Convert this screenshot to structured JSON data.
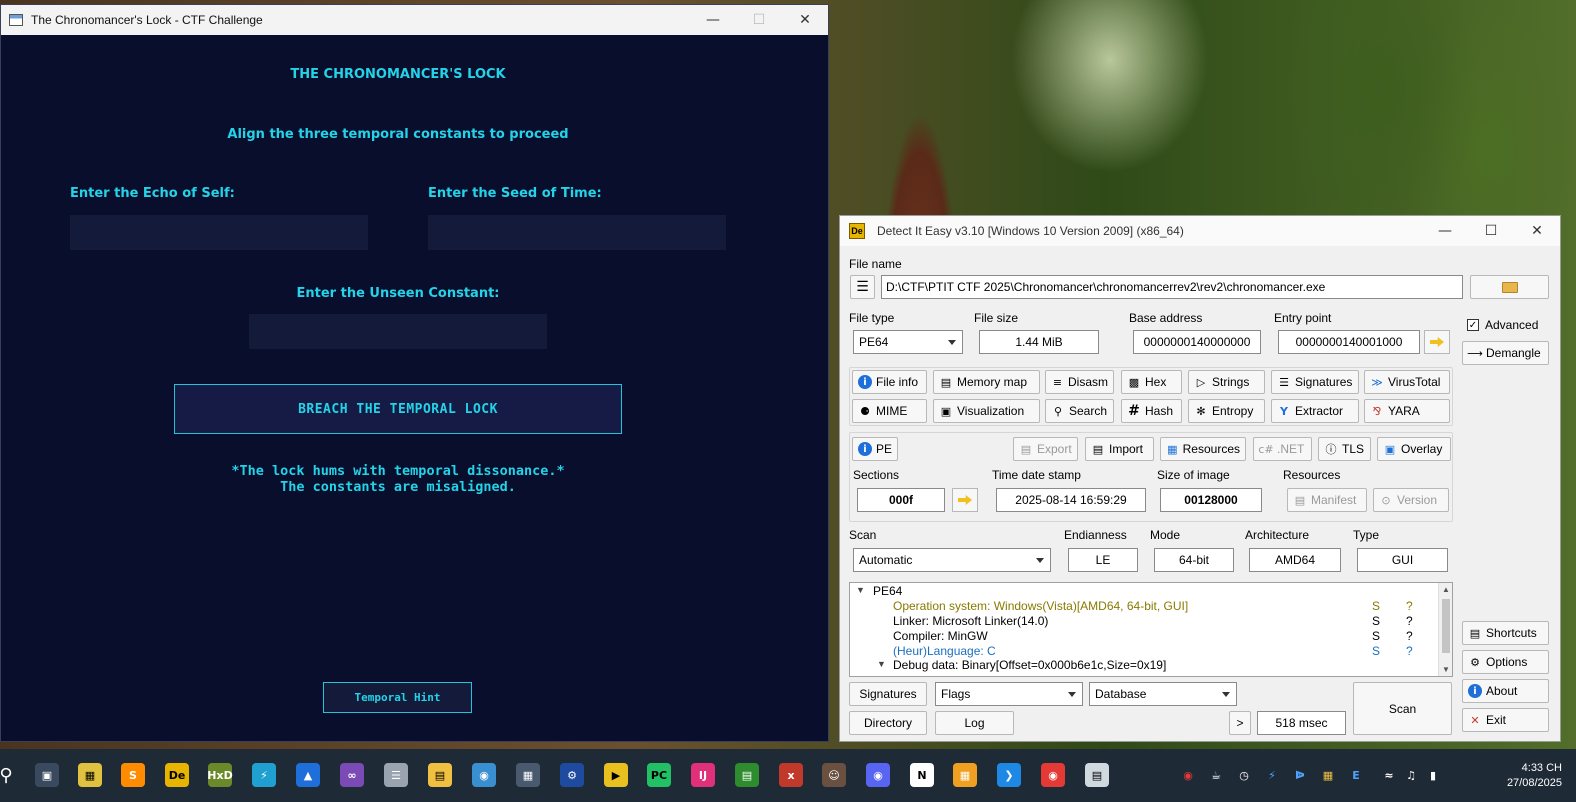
{
  "game": {
    "window_title": "The Chronomancer's Lock - CTF Challenge",
    "heading": "THE CHRONOMANCER'S LOCK",
    "subtitle": "Align the three temporal constants to proceed",
    "label_echo": "Enter the Echo of Self:",
    "label_seed": "Enter the Seed of Time:",
    "label_unseen": "Enter the Unseen Constant:",
    "input_echo": "",
    "input_seed": "",
    "input_unseen": "",
    "breach_button": "BREACH THE TEMPORAL LOCK",
    "status_line1": "*The lock hums with temporal dissonance.*",
    "status_line2": "The constants are misaligned.",
    "hint_button": "Temporal Hint",
    "colors": {
      "background": "#0a0e2d",
      "accent": "#23d3e8"
    }
  },
  "die": {
    "window_title": "Detect It Easy v3.10 [Windows 10 Version 2009] (x86_64)",
    "file_name_label": "File name",
    "file_path": "D:\\CTF\\PTIT CTF 2025\\Chronomancer\\chronomancerrev2\\rev2\\chronomancer.exe",
    "file_type_label": "File type",
    "file_type_value": "PE64",
    "file_size_label": "File size",
    "file_size_value": "1.44 MiB",
    "base_address_label": "Base address",
    "base_address_value": "0000000140000000",
    "entry_point_label": "Entry point",
    "entry_point_value": "0000000140001000",
    "advanced_label": "Advanced",
    "advanced_checked": true,
    "demangle": "Demangle",
    "tools_row1": [
      "File info",
      "Memory map",
      "Disasm",
      "Hex",
      "Strings",
      "Signatures",
      "VirusTotal"
    ],
    "tools_row2": [
      "MIME",
      "Visualization",
      "Search",
      "Hash",
      "Entropy",
      "Extractor",
      "YARA"
    ],
    "pe_button": "PE",
    "pe_tools": [
      "Export",
      "Import",
      "Resources",
      ".NET",
      "TLS",
      "Overlay"
    ],
    "sections_label": "Sections",
    "sections_value": "000f",
    "timestamp_label": "Time date stamp",
    "timestamp_value": "2025-08-14 16:59:29",
    "size_of_image_label": "Size of image",
    "size_of_image_value": "00128000",
    "resources_label": "Resources",
    "manifest_button": "Manifest",
    "version_button": "Version",
    "scan_label": "Scan",
    "scan_value": "Automatic",
    "endianness_label": "Endianness",
    "endianness_value": "LE",
    "mode_label": "Mode",
    "mode_value": "64-bit",
    "architecture_label": "Architecture",
    "architecture_value": "AMD64",
    "type_label": "Type",
    "type_value": "GUI",
    "results": {
      "root": "PE64",
      "rows": [
        {
          "text": "Operation system: Windows(Vista)[AMD64, 64-bit, GUI]",
          "color": "#8a7a00",
          "s": "S",
          "q": "?"
        },
        {
          "text": "Linker: Microsoft Linker(14.0)",
          "color": "#000000",
          "s": "S",
          "q": "?"
        },
        {
          "text": "Compiler: MinGW",
          "color": "#000000",
          "s": "S",
          "q": "?"
        },
        {
          "text": "(Heur)Language: C",
          "color": "#1a6fc0",
          "s": "S",
          "q": "?"
        }
      ],
      "debug_row": "Debug data: Binary[Offset=0x000b6e1c,Size=0x19]"
    },
    "signatures_button": "Signatures",
    "flags_value": "Flags",
    "database_value": "Database",
    "directory_button": "Directory",
    "log_button": "Log",
    "more_button": ">",
    "scan_time": "518 msec",
    "scan_button": "Scan",
    "shortcuts_button": "Shortcuts",
    "options_button": "Options",
    "about_button": "About",
    "exit_button": "Exit"
  },
  "taskbar": {
    "time": "4:33 CH",
    "date": "27/08/2025"
  }
}
